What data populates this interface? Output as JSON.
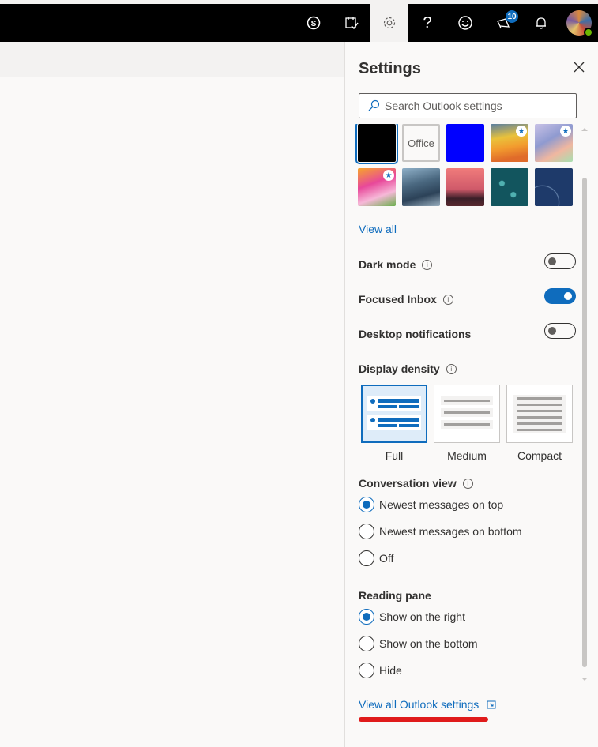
{
  "topbar": {
    "icons": [
      {
        "name": "skype-icon"
      },
      {
        "name": "my-day-icon"
      },
      {
        "name": "settings-gear-icon",
        "active": true
      },
      {
        "name": "help-icon",
        "label": "?"
      },
      {
        "name": "feedback-smiley-icon"
      },
      {
        "name": "whats-new-megaphone-icon",
        "badge": "10"
      },
      {
        "name": "notifications-bell-icon"
      },
      {
        "name": "account-avatar",
        "presence": "available"
      }
    ]
  },
  "settings": {
    "title": "Settings",
    "search_placeholder": "Search Outlook settings",
    "themes": [
      {
        "name": "black",
        "selected": true,
        "starred": false
      },
      {
        "name": "Office",
        "label": "Office",
        "starred": false
      },
      {
        "name": "blue",
        "starred": false
      },
      {
        "name": "rainbow-waves",
        "starred": true
      },
      {
        "name": "pastel-ribbons",
        "starred": true
      },
      {
        "name": "unicorn",
        "starred": true
      },
      {
        "name": "ocean-wave",
        "starred": false
      },
      {
        "name": "palm-sunset",
        "starred": false
      },
      {
        "name": "circuit",
        "starred": false
      },
      {
        "name": "blueprint",
        "starred": false
      }
    ],
    "view_all": "View all",
    "toggles": [
      {
        "label": "Dark mode",
        "info": true,
        "on": false
      },
      {
        "label": "Focused Inbox",
        "info": true,
        "on": true
      },
      {
        "label": "Desktop notifications",
        "info": false,
        "on": false
      }
    ],
    "display_density": {
      "label": "Display density",
      "options": [
        "Full",
        "Medium",
        "Compact"
      ],
      "selected": "Full"
    },
    "conversation_view": {
      "label": "Conversation view",
      "options": [
        "Newest messages on top",
        "Newest messages on bottom",
        "Off"
      ],
      "selected": "Newest messages on top"
    },
    "reading_pane": {
      "label": "Reading pane",
      "options": [
        "Show on the right",
        "Show on the bottom",
        "Hide"
      ],
      "selected": "Show on the right"
    },
    "view_all_settings": "View all Outlook settings",
    "info_glyph": "i",
    "star_glyph": "★"
  },
  "colors": {
    "accent": "#0f6cbd",
    "annotation": "#e01b1b"
  }
}
